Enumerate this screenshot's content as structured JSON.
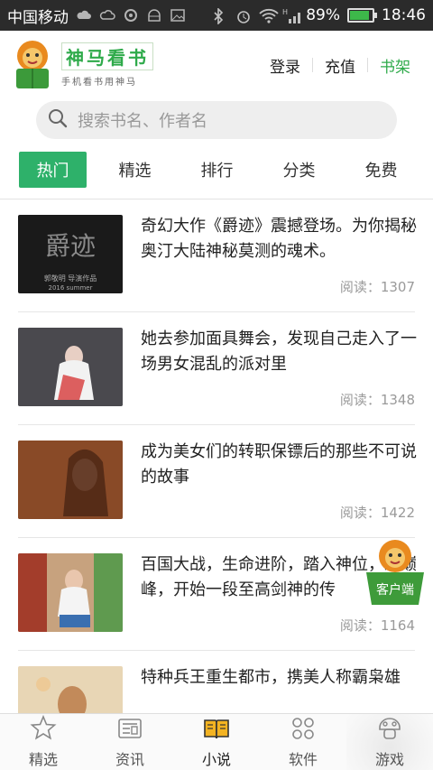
{
  "status_bar": {
    "carrier": "中国移动",
    "battery_percent": "89%",
    "battery_level": 0.89,
    "time": "18:46",
    "network": "H"
  },
  "header": {
    "logo_title": "神马看书",
    "logo_subtitle": "手机看书用神马",
    "links": [
      {
        "label": "登录"
      },
      {
        "label": "充值"
      },
      {
        "label": "书架"
      }
    ]
  },
  "search": {
    "placeholder": "搜索书名、作者名"
  },
  "tabs": [
    {
      "label": "热门",
      "active": true
    },
    {
      "label": "精选"
    },
    {
      "label": "排行"
    },
    {
      "label": "分类"
    },
    {
      "label": "免费"
    }
  ],
  "books": [
    {
      "title": "奇幻大作《爵迹》震撼登场。为你揭秘奥汀大陆神秘莫测的魂术。",
      "reads": "阅读：1307",
      "thumb_caption": "爵迹",
      "thumb_credit": "郭敬明 导演作品",
      "thumb_year": "2016 summer"
    },
    {
      "title": "她去参加面具舞会，发现自己走入了一场男女混乱的派对里",
      "reads": "阅读：1348"
    },
    {
      "title": "成为美女们的转职保镖后的那些不可说的故事",
      "reads": "阅读：1422"
    },
    {
      "title": "百国大战，生命进阶，踏入神位，凌巅峰，开始一段至高剑神的传",
      "reads": "阅读：1164"
    },
    {
      "title": "特种兵王重生都市，携美人称霸枭雄",
      "reads": ""
    }
  ],
  "floating_button": {
    "label": "客户端"
  },
  "bottom_nav": [
    {
      "label": "精选",
      "icon": "star-icon"
    },
    {
      "label": "资讯",
      "icon": "news-icon"
    },
    {
      "label": "小说",
      "icon": "book-icon",
      "active": true
    },
    {
      "label": "软件",
      "icon": "apps-icon"
    },
    {
      "label": "游戏",
      "icon": "game-icon"
    }
  ],
  "colors": {
    "accent": "#2eb16a",
    "logo_green": "#2eaa4a",
    "status_bar": "#2b2b2b"
  }
}
